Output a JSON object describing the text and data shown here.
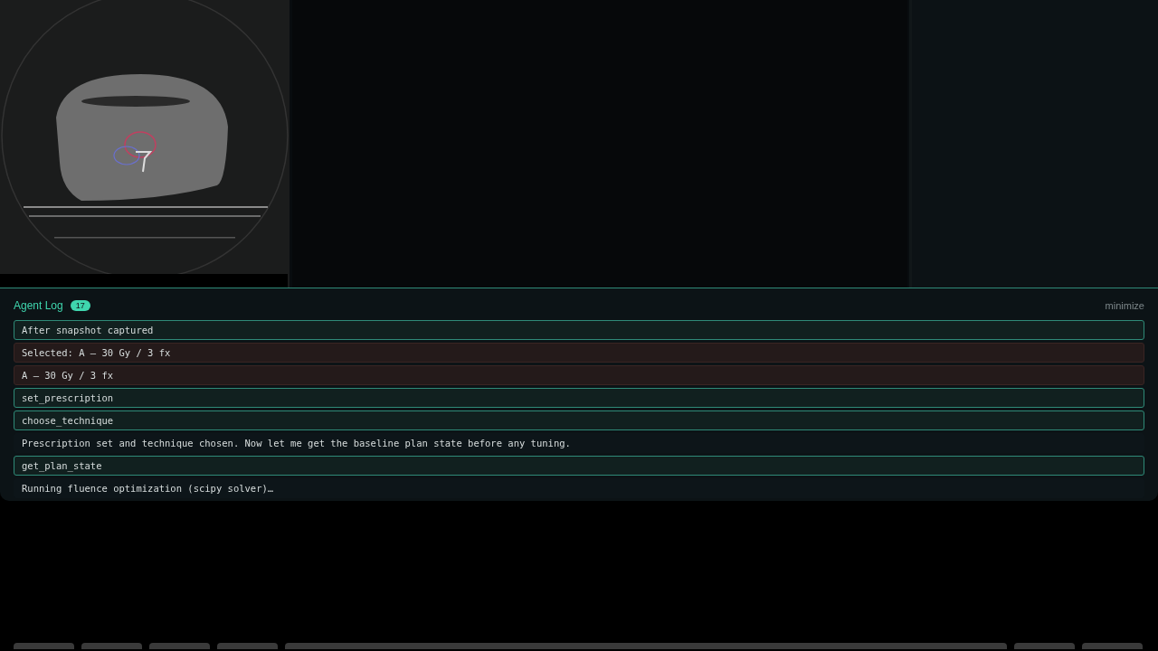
{
  "agent_log": {
    "title": "Agent Log",
    "count": "17",
    "minimize": "minimize",
    "entries": [
      {
        "kind": "tool",
        "text": "After snapshot captured"
      },
      {
        "kind": "selection",
        "text": "Selected: A — 30 Gy / 3 fx"
      },
      {
        "kind": "selection",
        "text": "A — 30 Gy / 3 fx"
      },
      {
        "kind": "tool",
        "text": "set_prescription"
      },
      {
        "kind": "tool",
        "text": "choose_technique"
      },
      {
        "kind": "message",
        "text": "Prescription set and technique chosen. Now let me get the baseline plan state before any tuning."
      },
      {
        "kind": "tool",
        "text": "get_plan_state"
      },
      {
        "kind": "message",
        "text": "Running fluence optimization (scipy solver)…"
      }
    ]
  }
}
